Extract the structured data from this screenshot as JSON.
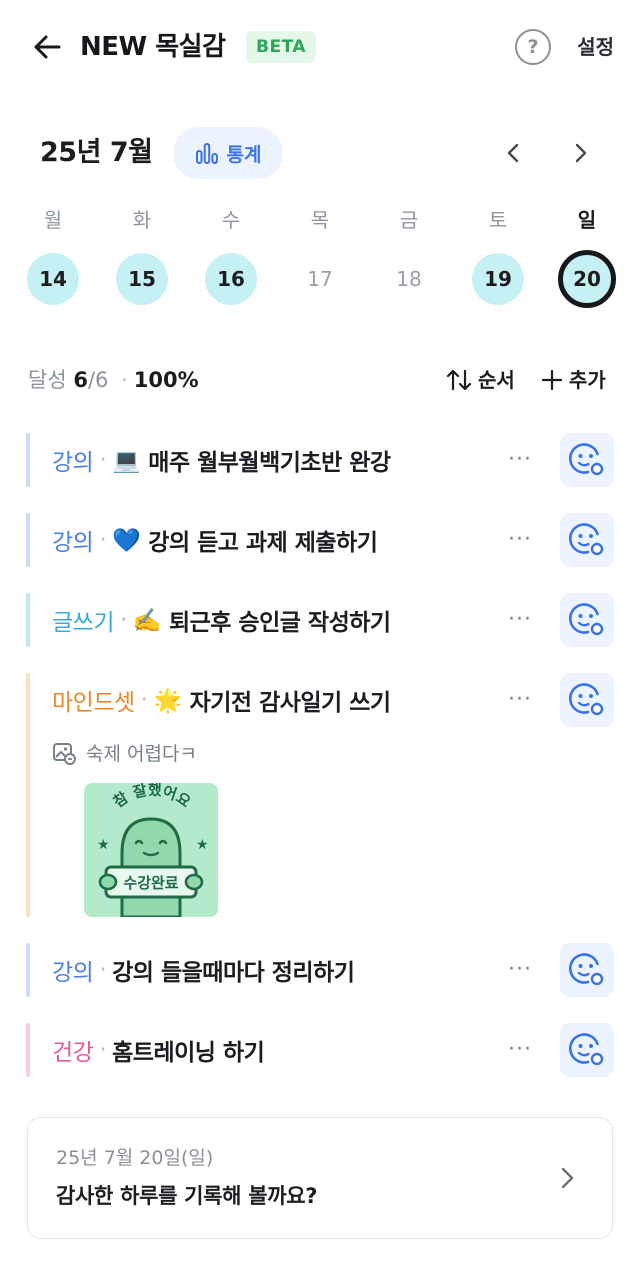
{
  "header": {
    "title": "NEW 목실감",
    "badge": "BETA",
    "help_glyph": "?",
    "settings_label": "설정",
    "back_icon": "arrow-left-icon"
  },
  "calendar": {
    "month_label": "25년 7월",
    "stats_label": "통계",
    "stats_icon": "bar-chart-icon",
    "days": [
      {
        "name": "월",
        "date": "14",
        "state": "done"
      },
      {
        "name": "화",
        "date": "15",
        "state": "done"
      },
      {
        "name": "수",
        "date": "16",
        "state": "done"
      },
      {
        "name": "목",
        "date": "17",
        "state": "empty"
      },
      {
        "name": "금",
        "date": "18",
        "state": "empty"
      },
      {
        "name": "토",
        "date": "19",
        "state": "done"
      },
      {
        "name": "일",
        "date": "20",
        "state": "today"
      }
    ]
  },
  "summary": {
    "label": "달성",
    "done": "6",
    "total": "/6",
    "percent": "100%",
    "order_label": "순서",
    "add_label": "추가"
  },
  "tasks": [
    {
      "category": "강의",
      "category_color": "#4a7fe0",
      "emoji": "💻",
      "text": "매주 월부월백기초반 완강"
    },
    {
      "category": "강의",
      "category_color": "#4a7fe0",
      "emoji": "💙",
      "text": "강의 듣고 과제 제출하기"
    },
    {
      "category": "글쓰기",
      "category_color": "#3aa9d6",
      "emoji": "✍️",
      "text": "퇴근후 승인글 작성하기"
    },
    {
      "category": "마인드셋",
      "category_color": "#e8892b",
      "emoji": "🌟",
      "text": "자기전 감사일기 쓰기",
      "memo": "숙제 어렵다ㅋ",
      "sticker_text": "참 잘했어요",
      "sticker_sign": "수강완료"
    },
    {
      "category": "강의",
      "category_color": "#4a7fe0",
      "emoji": "",
      "text": "강의 들을때마다 정리하기"
    },
    {
      "category": "건강",
      "category_color": "#e05aa0",
      "emoji": "",
      "text": "홈트레이닝 하기"
    }
  ],
  "more_label": "···",
  "diary": {
    "date": "25년 7월 20일(일)",
    "prompt": "감사한 하루를 기록해 볼까요?"
  },
  "colors": {
    "accent": "#3b73e6",
    "done_day": "#c5f0f4",
    "beta_bg": "#e4f7e9",
    "beta_text": "#2ea65a",
    "sticker_bg": "#b4eacc",
    "sticker_ink": "#1f6b46"
  }
}
